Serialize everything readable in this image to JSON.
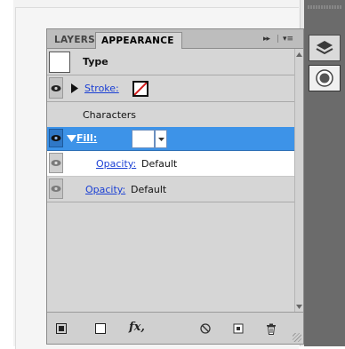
{
  "tabs": [
    {
      "label": "LAYERS"
    },
    {
      "label": "APPEARANCE"
    }
  ],
  "panel_menu": {
    "collapse_glyph": "▸▸",
    "separator": "|",
    "menu_glyph": "▾≡"
  },
  "rows": {
    "type": {
      "label": "Type"
    },
    "stroke": {
      "label": "Stroke:"
    },
    "characters": {
      "label": "Characters"
    },
    "fill": {
      "label": "Fill:",
      "swatch_color": "#ffffff"
    },
    "opacity_nested": {
      "label": "Opacity:",
      "value": "Default"
    },
    "opacity": {
      "label": "Opacity:",
      "value": "Default"
    }
  },
  "bottom_toolbar": {
    "fx_label": "fx,"
  },
  "colors": {
    "selection": "#3d93e8",
    "panel_bg": "#d6d6d6",
    "link": "#1a3fd4",
    "dock_bg": "#6b6b6b"
  },
  "icons": [
    "eye-icon",
    "new-art-icon",
    "new-swatch-icon",
    "fx-icon",
    "clear-appearance-icon",
    "duplicate-item-icon",
    "delete-item-icon",
    "layers-diamond-icon",
    "color-circle-icon"
  ]
}
